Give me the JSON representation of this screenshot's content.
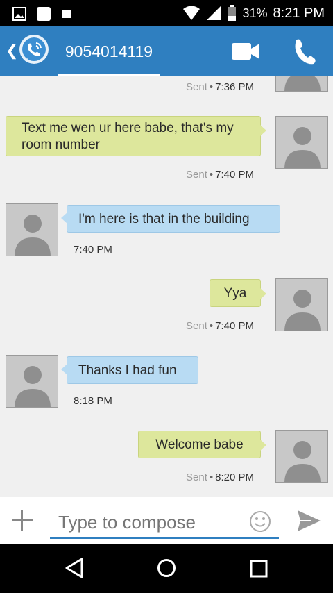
{
  "status": {
    "battery": "31%",
    "time": "8:21 PM"
  },
  "header": {
    "phone_number": "9054014119",
    "icons": [
      "back-icon",
      "app-logo-icon",
      "video-call-icon",
      "phone-call-icon"
    ]
  },
  "messages": [
    {
      "direction": "sent",
      "sent_label": "Sent",
      "time": "7:36 PM",
      "text": ""
    },
    {
      "direction": "sent",
      "text_line1": "Text me wen ur here babe, that's my",
      "text_line2": "room number",
      "sent_label": "Sent",
      "time": "7:40 PM"
    },
    {
      "direction": "received",
      "text": "I'm here is that in the building",
      "time": "7:40 PM"
    },
    {
      "direction": "sent",
      "text": "Yya",
      "sent_label": "Sent",
      "time": "7:40 PM"
    },
    {
      "direction": "received",
      "text": "Thanks I had fun",
      "time": "8:18 PM"
    },
    {
      "direction": "sent",
      "text": "Welcome babe",
      "sent_label": "Sent",
      "time": "8:20 PM"
    }
  ],
  "compose": {
    "placeholder": "Type to compose",
    "value": ""
  },
  "colors": {
    "app_bar": "#2f7fc0",
    "sent_bubble": "#dde79c",
    "received_bubble": "#b8dbf3"
  }
}
